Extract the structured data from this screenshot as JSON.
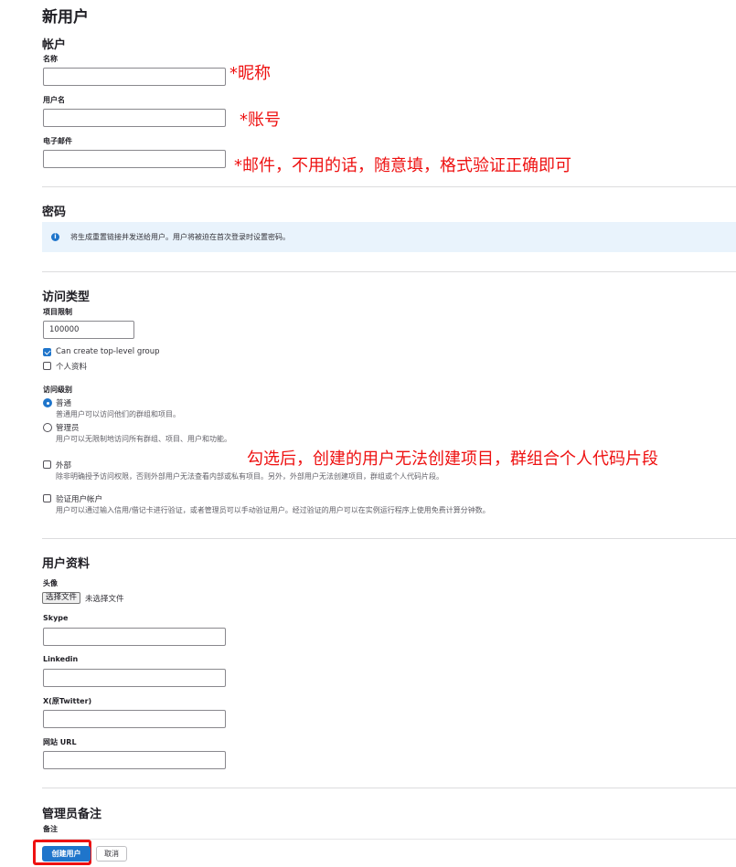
{
  "page_title": "新用户",
  "account": {
    "title": "帐户",
    "name_label": "名称",
    "username_label": "用户名",
    "email_label": "电子邮件",
    "name_value": "",
    "username_value": "",
    "email_value": ""
  },
  "password": {
    "title": "密码",
    "info_icon": "info-icon",
    "alert_text": "将生成重置链接并发送给用户。用户将被迫在首次登录时设置密码。"
  },
  "access": {
    "title": "访问类型",
    "project_limit_label": "项目限制",
    "project_limit_value": "100000",
    "can_create_group_label": "Can create top-level group",
    "can_create_group_checked": true,
    "private_profile_label": "个人资料",
    "private_profile_checked": false,
    "access_level_label": "访问级别",
    "levels": [
      {
        "label": "普通",
        "help": "普通用户可以访问他们的群组和项目。",
        "selected": true
      },
      {
        "label": "管理员",
        "help": "用户可以无限制地访问所有群组、项目、用户和功能。",
        "selected": false
      }
    ],
    "external_label": "外部",
    "external_help": "除非明确授予访问权限，否则外部用户无法查看内部或私有项目。另外，外部用户无法创建项目，群组或个人代码片段。",
    "external_checked": false,
    "validate_label": "验证用户帐户",
    "validate_help": "用户可以通过输入信用/借记卡进行验证，或者管理员可以手动验证用户。经过验证的用户可以在实例运行程序上使用免费计算分钟数。",
    "validate_checked": false
  },
  "profile": {
    "title": "用户资料",
    "avatar_label": "头像",
    "choose_file_button": "选择文件",
    "no_file_text": "未选择文件",
    "skype_label": "Skype",
    "linkedin_label": "Linkedin",
    "twitter_label": "X(原Twitter)",
    "website_label": "网站 URL"
  },
  "admin_notes": {
    "title": "管理员备注",
    "note_label": "备注"
  },
  "actions": {
    "create_label": "创建用户",
    "cancel_label": "取消"
  },
  "annotations": {
    "nickname": "*昵称",
    "username": "*账号",
    "email": "*邮件，不用的话，随意填，格式验证正确即可",
    "external": "勾选后，创建的用户无法创建项目，群组合个人代码片段",
    "color": "#ee1111"
  },
  "colors": {
    "primary": "#1f75cb",
    "alert_bg": "#e9f3fc"
  }
}
